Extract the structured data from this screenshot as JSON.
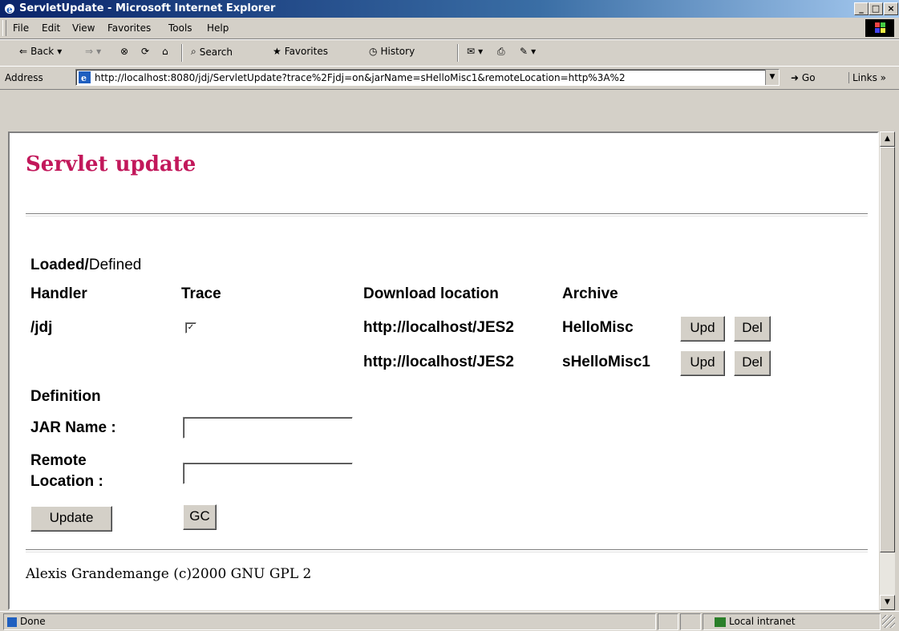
{
  "window": {
    "title": "ServletUpdate - Microsoft Internet Explorer",
    "minimize": "_",
    "maximize": "□",
    "close": "×"
  },
  "menu": [
    "File",
    "Edit",
    "View",
    "Favorites",
    "Tools",
    "Help"
  ],
  "toolbar": {
    "back": "Back",
    "search": "Search",
    "favorites": "Favorites",
    "history": "History"
  },
  "address": {
    "label": "Address",
    "url": "http://localhost:8080/jdj/ServletUpdate?trace%2Fjdj=on&jarName=sHelloMisc1&remoteLocation=http%3A%2",
    "go": "Go",
    "links": "Links"
  },
  "page": {
    "title": "Servlet update",
    "loaded_label": "Loaded/",
    "defined_label": "Defined",
    "headers": {
      "handler": "Handler",
      "trace": "Trace",
      "download": "Download location",
      "archive": "Archive"
    },
    "handler_row": {
      "handler": "/jdj",
      "trace_checked": "✓"
    },
    "archives": [
      {
        "location": "http://localhost/JES2",
        "archive": "HelloMisc",
        "upd": "Upd",
        "del": "Del"
      },
      {
        "location": "http://localhost/JES2",
        "archive": "sHelloMisc1",
        "upd": "Upd",
        "del": "Del"
      }
    ],
    "definition_label": "Definition",
    "jar_name_label": "JAR Name :",
    "jar_name_value": "",
    "remote_label_1": "Remote",
    "remote_label_2": "Location :",
    "remote_value": "",
    "update_button": "Update",
    "gc_button": "GC",
    "footer": "Alexis Grandemange (c)2000 GNU GPL 2"
  },
  "status": {
    "text": "Done",
    "zone": "Local intranet"
  },
  "colors": {
    "title": "#c2185b",
    "chrome": "#d4d0c8"
  }
}
